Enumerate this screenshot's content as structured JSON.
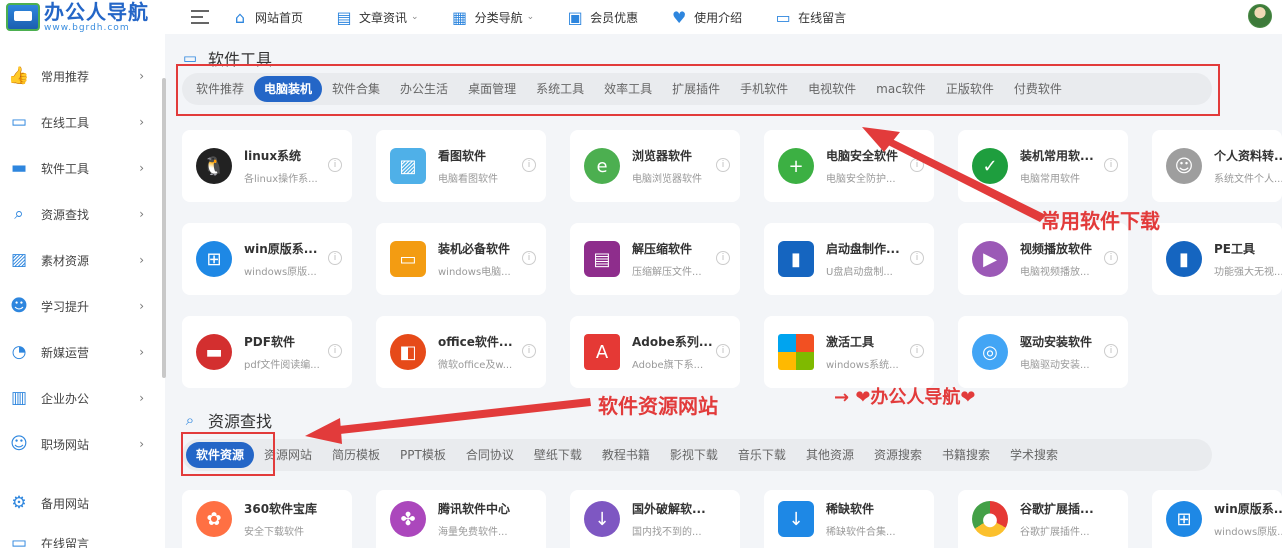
{
  "header": {
    "logo_title": "办公人导航",
    "logo_sub": "www.bgrdh.com",
    "nav": [
      {
        "label": "网站首页",
        "icon": "home-icon",
        "caret": false
      },
      {
        "label": "文章资讯",
        "icon": "document-icon",
        "caret": true
      },
      {
        "label": "分类导航",
        "icon": "grid-icon",
        "caret": true
      },
      {
        "label": "会员优惠",
        "icon": "shop-icon",
        "caret": false
      },
      {
        "label": "使用介绍",
        "icon": "heart-icon",
        "caret": false
      },
      {
        "label": "在线留言",
        "icon": "chat-icon",
        "caret": false
      }
    ]
  },
  "sidebar": {
    "items": [
      {
        "label": "常用推荐",
        "icon": "thumbs-up-icon",
        "color": "#f5a623"
      },
      {
        "label": "在线工具",
        "icon": "toolbox-icon",
        "color": "#2e86de"
      },
      {
        "label": "软件工具",
        "icon": "monitor-icon",
        "color": "#2e86de"
      },
      {
        "label": "资源查找",
        "icon": "search-icon",
        "color": "#2e86de"
      },
      {
        "label": "素材资源",
        "icon": "image-icon",
        "color": "#2e86de"
      },
      {
        "label": "学习提升",
        "icon": "user-study-icon",
        "color": "#2e86de"
      },
      {
        "label": "新媒运营",
        "icon": "pie-chart-icon",
        "color": "#2e86de"
      },
      {
        "label": "企业办公",
        "icon": "calendar-icon",
        "color": "#2e86de"
      },
      {
        "label": "职场网站",
        "icon": "users-icon",
        "color": "#2e86de"
      },
      {
        "label": "备用网站",
        "icon": "gear-icon",
        "color": "#2e86de"
      },
      {
        "label": "在线留言",
        "icon": "chat-icon",
        "color": "#2e86de"
      }
    ]
  },
  "software": {
    "title": "软件工具",
    "tabs": [
      "软件推荐",
      "电脑装机",
      "软件合集",
      "办公生活",
      "桌面管理",
      "系统工具",
      "效率工具",
      "扩展插件",
      "手机软件",
      "电视软件",
      "mac软件",
      "正版软件",
      "付费软件"
    ],
    "active_tab": 1,
    "cards": [
      {
        "title": "linux系统",
        "desc": "各linux操作系...",
        "icon": "penguin-icon",
        "color": "#222222"
      },
      {
        "title": "看图软件",
        "desc": "电脑看图软件",
        "icon": "picture-icon",
        "color": "#4fb0e8"
      },
      {
        "title": "浏览器软件",
        "desc": "电脑浏览器软件",
        "icon": "browser-icon",
        "color": "#4caf50"
      },
      {
        "title": "电脑安全软件",
        "desc": "电脑安全防护...",
        "icon": "shield-plus-icon",
        "color": "#3cb043"
      },
      {
        "title": "装机常用软...",
        "desc": "电脑常用软件",
        "icon": "check-shield-icon",
        "color": "#1e9e3e"
      },
      {
        "title": "个人资料转...",
        "desc": "系统文件个人...",
        "icon": "person-icon",
        "color": "#9e9e9e"
      },
      {
        "title": "win原版系...",
        "desc": "windows原版...",
        "icon": "windows-icon",
        "color": "#1e88e5"
      },
      {
        "title": "装机必备软件",
        "desc": "windows电脑...",
        "icon": "monitor-colors-icon",
        "color": "#f39c12"
      },
      {
        "title": "解压缩软件",
        "desc": "压缩解压文件...",
        "icon": "archive-icon",
        "color": "#8e2d8c"
      },
      {
        "title": "启动盘制作...",
        "desc": "U盘启动盘制...",
        "icon": "usb-icon",
        "color": "#1565c0"
      },
      {
        "title": "视频播放软件",
        "desc": "电脑视频播放...",
        "icon": "play-icon",
        "color": "#9b59b6"
      },
      {
        "title": "PE工具",
        "desc": "功能强大无视...",
        "icon": "usb-drive-icon",
        "color": "#1565c0"
      },
      {
        "title": "PDF软件",
        "desc": "pdf文件阅读编...",
        "icon": "pdf-icon",
        "color": "#d32f2f"
      },
      {
        "title": "office软件...",
        "desc": "微软office及w...",
        "icon": "office-icon",
        "color": "#e64a19"
      },
      {
        "title": "Adobe系列...",
        "desc": "Adobe旗下系...",
        "icon": "adobe-icon",
        "color": "#e53935"
      },
      {
        "title": "激活工具",
        "desc": "windows系统...",
        "icon": "windows-color-icon",
        "color": "#43a047"
      },
      {
        "title": "驱动安装软件",
        "desc": "电脑驱动安装...",
        "icon": "driver-icon",
        "color": "#42a5f5"
      }
    ]
  },
  "resources": {
    "title": "资源查找",
    "tabs": [
      "软件资源",
      "资源网站",
      "简历模板",
      "PPT模板",
      "合同协议",
      "壁纸下载",
      "教程书籍",
      "影视下载",
      "音乐下载",
      "其他资源",
      "资源搜索",
      "书籍搜索",
      "学术搜索"
    ],
    "active_tab": 0,
    "cards": [
      {
        "title": "360软件宝库",
        "desc": "安全下载软件",
        "icon": "flower-icon",
        "color": "#ff7043"
      },
      {
        "title": "腾讯软件中心",
        "desc": "海量免费软件...",
        "icon": "pinwheel-icon",
        "color": "#ab47bc"
      },
      {
        "title": "国外破解软...",
        "desc": "国内找不到的...",
        "icon": "download-icon",
        "color": "#7e57c2"
      },
      {
        "title": "稀缺软件",
        "desc": "稀缺软件合集...",
        "icon": "folder-download-icon",
        "color": "#1e88e5"
      },
      {
        "title": "谷歌扩展插...",
        "desc": "谷歌扩展插件...",
        "icon": "chrome-icon",
        "color": "#e53935"
      },
      {
        "title": "win原版系...",
        "desc": "windows原版...",
        "icon": "windows-icon",
        "color": "#1e88e5"
      }
    ]
  },
  "annotations": {
    "common_download": "常用软件下载",
    "resource_site": "软件资源网站",
    "brand": "→ ❤办公人导航❤"
  },
  "colors": {
    "accent": "#2466c7",
    "annotation": "#e23b3b"
  }
}
